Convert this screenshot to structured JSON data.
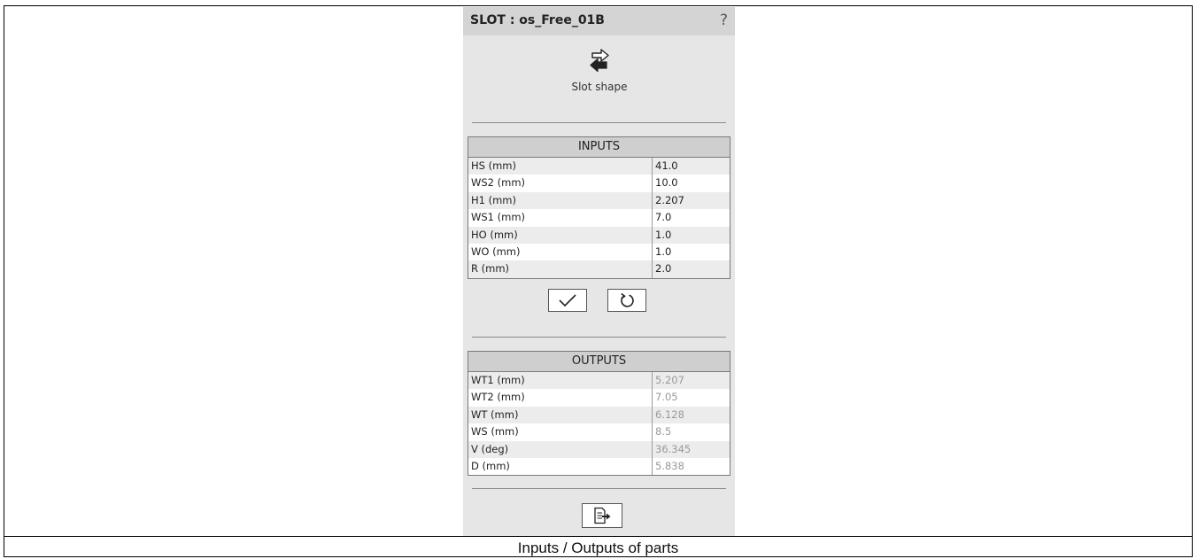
{
  "panel": {
    "title": "SLOT : os_Free_01B",
    "help": "?",
    "shape_label": "Slot shape"
  },
  "inputs": {
    "header": "INPUTS",
    "rows": [
      {
        "label": "HS (mm)",
        "value": "41.0"
      },
      {
        "label": "WS2 (mm)",
        "value": "10.0"
      },
      {
        "label": "H1 (mm)",
        "value": "2.207"
      },
      {
        "label": "WS1 (mm)",
        "value": "7.0"
      },
      {
        "label": "HO (mm)",
        "value": "1.0"
      },
      {
        "label": "WO (mm)",
        "value": "1.0"
      },
      {
        "label": "R (mm)",
        "value": "2.0"
      }
    ]
  },
  "outputs": {
    "header": "OUTPUTS",
    "rows": [
      {
        "label": "WT1 (mm)",
        "value": "5.207"
      },
      {
        "label": "WT2 (mm)",
        "value": "7.05"
      },
      {
        "label": "WT (mm)",
        "value": "6.128"
      },
      {
        "label": "WS (mm)",
        "value": "8.5"
      },
      {
        "label": "V (deg)",
        "value": "36.345"
      },
      {
        "label": "D (mm)",
        "value": "5.838"
      }
    ]
  },
  "icons": {
    "shape": "swap-arrows-icon",
    "apply": "checkmark-icon",
    "reset": "undo-icon",
    "export": "export-document-icon",
    "help": "question-mark-icon"
  },
  "caption": "Inputs / Outputs of parts"
}
